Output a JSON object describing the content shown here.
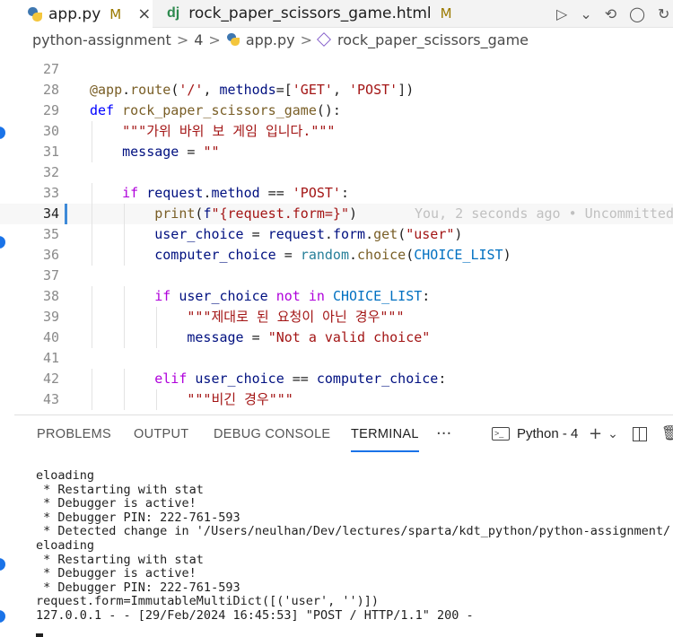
{
  "tabs": [
    {
      "name": "app.py",
      "status": "M",
      "close": "×"
    },
    {
      "name": "rock_paper_scissors_game.html",
      "status": "M",
      "badge": "dj"
    }
  ],
  "editor_actions": [
    "▷",
    "⌄",
    "⟲",
    "◯",
    "↻"
  ],
  "breadcrumb": {
    "folder": "python-assignment",
    "num": "4",
    "file": "app.py",
    "symbol": "rock_paper_scissors_game",
    "sep": ">"
  },
  "code": {
    "blame": "You, 2 seconds ago • Uncommitted",
    "lines": [
      {
        "n": "27",
        "t": ""
      },
      {
        "n": "28",
        "t": "@app.route('/', methods=['GET', 'POST'])"
      },
      {
        "n": "29",
        "t": "def rock_paper_scissors_game():"
      },
      {
        "n": "30",
        "t": "    \"\"\"가위 바위 보 게임 입니다.\"\"\""
      },
      {
        "n": "31",
        "t": "    message = \"\""
      },
      {
        "n": "32",
        "t": ""
      },
      {
        "n": "33",
        "t": "    if request.method == 'POST':"
      },
      {
        "n": "34",
        "t": "        print(f\"{request.form=}\")"
      },
      {
        "n": "35",
        "t": "        user_choice = request.form.get(\"user\")"
      },
      {
        "n": "36",
        "t": "        computer_choice = random.choice(CHOICE_LIST)"
      },
      {
        "n": "37",
        "t": ""
      },
      {
        "n": "38",
        "t": "        if user_choice not in CHOICE_LIST:"
      },
      {
        "n": "39",
        "t": "            \"\"\"제대로 된 요청이 아닌 경우\"\"\""
      },
      {
        "n": "40",
        "t": "            message = \"Not a valid choice\""
      },
      {
        "n": "41",
        "t": ""
      },
      {
        "n": "42",
        "t": "        elif user_choice == computer_choice:"
      },
      {
        "n": "43",
        "t": "            \"\"\"비긴 경우\"\"\""
      }
    ]
  },
  "panel": {
    "tabs": [
      "PROBLEMS",
      "OUTPUT",
      "DEBUG CONSOLE",
      "TERMINAL"
    ],
    "more": "···",
    "terminal_name": "Python - 4",
    "actions": {
      "add": "+",
      "chevron": "⌄",
      "trash": "🗑"
    }
  },
  "terminal_lines": [
    "eloading",
    " * Restarting with stat",
    " * Debugger is active!",
    " * Debugger PIN: 222-761-593",
    " * Detected change in '/Users/neulhan/Dev/lectures/sparta/kdt_python/python-assignment/",
    "eloading",
    " * Restarting with stat",
    " * Debugger is active!",
    " * Debugger PIN: 222-761-593",
    "request.form=ImmutableMultiDict([('user', '')])",
    "127.0.0.1 - - [29/Feb/2024 16:45:53] \"POST / HTTP/1.1\" 200 -"
  ]
}
